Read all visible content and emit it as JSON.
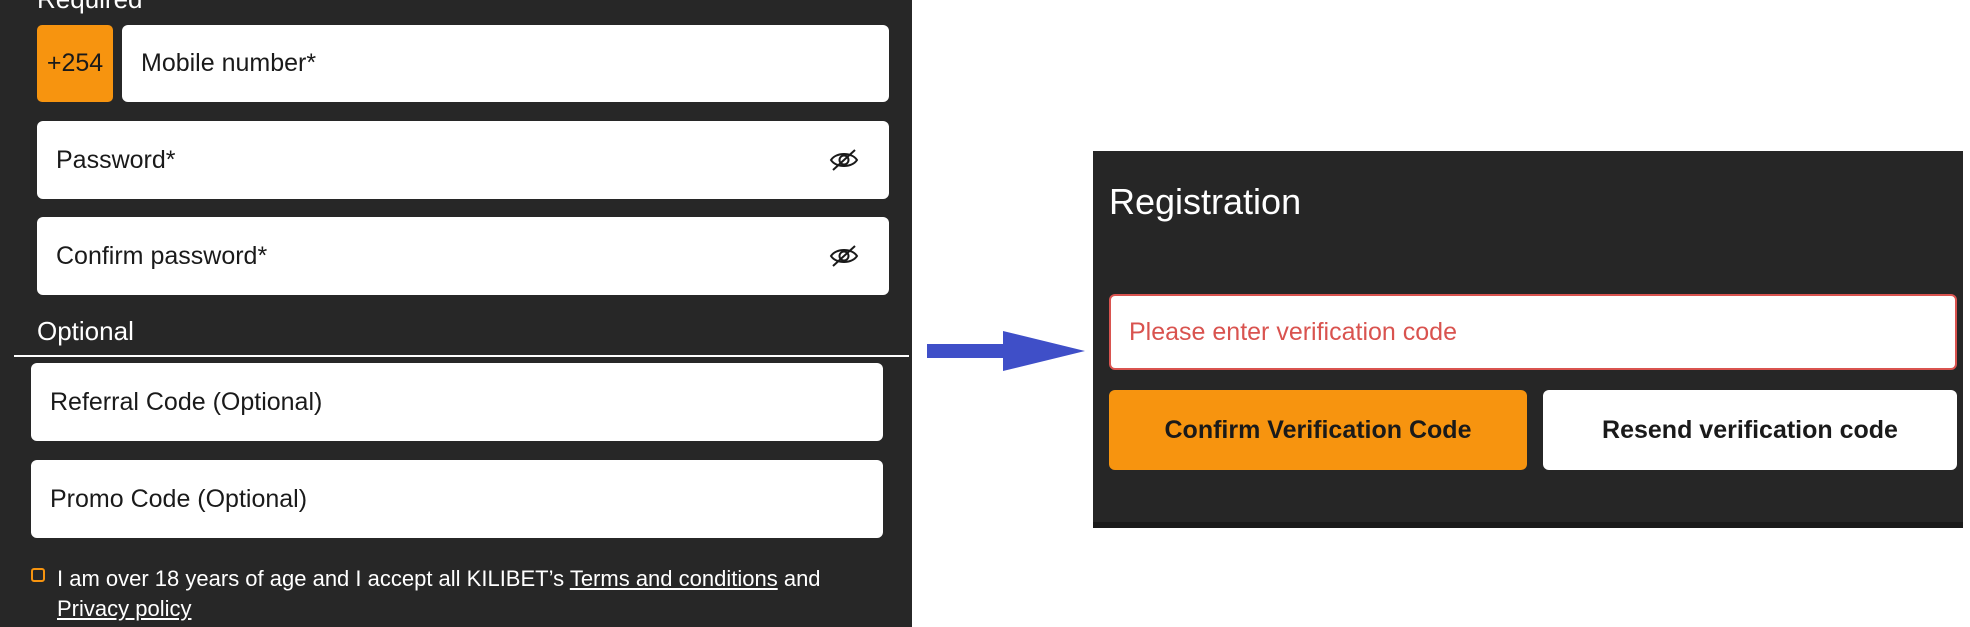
{
  "left_form": {
    "required_label": "Required",
    "country_code": "+254",
    "mobile_placeholder": "Mobile number*",
    "password_placeholder": "Password*",
    "confirm_password_placeholder": "Confirm password*",
    "optional_label": "Optional",
    "referral_placeholder": "Referral Code (Optional)",
    "promo_placeholder": "Promo Code (Optional)",
    "terms_prefix": "I am over 18 years of age and I accept all KILIBET’s",
    "terms_link": "Terms and conditions",
    "terms_and": "and",
    "privacy_link": "Privacy policy"
  },
  "registration_dialog": {
    "title": "Registration",
    "verification_placeholder": "Please enter verification code",
    "confirm_button": "Confirm Verification Code",
    "resend_button": "Resend verification code"
  },
  "icons": {
    "password_toggle": "eye-slash-icon",
    "arrow": "arrow-right-icon"
  },
  "colors": {
    "accent_orange": "#f7940f",
    "panel_dark": "#272727",
    "error_red": "#d9534f",
    "arrow_blue": "#3f4fc8"
  }
}
